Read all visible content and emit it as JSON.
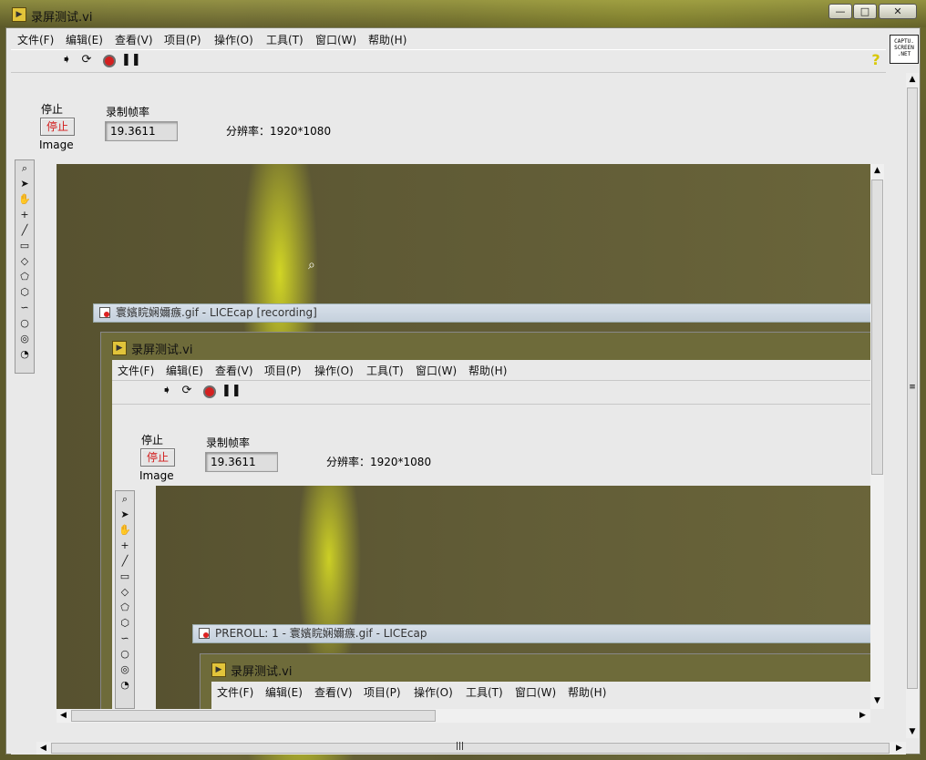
{
  "window": {
    "title": "录屏测试.vi",
    "icon_name": "labview-vi-icon",
    "controls": {
      "minimize": "—",
      "maximize": "□",
      "close": "✕"
    }
  },
  "menu": [
    "文件(F)",
    "编辑(E)",
    "查看(V)",
    "项目(P)",
    "操作(O)",
    "工具(T)",
    "窗口(W)",
    "帮助(H)"
  ],
  "toolbar": {
    "icons": [
      "run-arrow-icon",
      "run-continuously-icon",
      "abort-record-icon",
      "pause-icon"
    ],
    "help_glyph": "?"
  },
  "logo": {
    "line1": "CAPTU.",
    "line2": "SCREEN",
    "line3": ".NET"
  },
  "panel": {
    "stop_label": "停止",
    "stop_button": "停止",
    "image_label": "Image",
    "fps_label": "录制帧率",
    "fps_value": "19.3611",
    "resolution": "分辨率：1920*1080"
  },
  "palette_tools": [
    "zoom-icon",
    "pointer-icon",
    "pan-hand-icon",
    "point-crosshair-icon",
    "line-icon",
    "rectangle-icon",
    "rotated-rectangle-icon",
    "polygon-icon",
    "polyline-icon",
    "freehand-icon",
    "oval-icon",
    "annulus-icon",
    "broken-annulus-icon"
  ],
  "nested_1": {
    "licecap_title": "寰嬪睆娴嬭瘯.gif - LICEcap [recording]",
    "window_title": "录屏测试.vi",
    "stop_label": "停止",
    "stop_button": "停止",
    "image_label": "Image",
    "fps_label": "录制帧率",
    "fps_value": "19.3611",
    "resolution": "分辨率：1920*1080"
  },
  "nested_2": {
    "licecap_title": "PREROLL: 1 - 寰嬪睆娴嬭瘯.gif - LICEcap",
    "window_title": "录屏测试.vi"
  },
  "scroll_glyphs": {
    "up": "▲",
    "down": "▼",
    "left": "◀",
    "right": "▶",
    "grip": "≡"
  }
}
